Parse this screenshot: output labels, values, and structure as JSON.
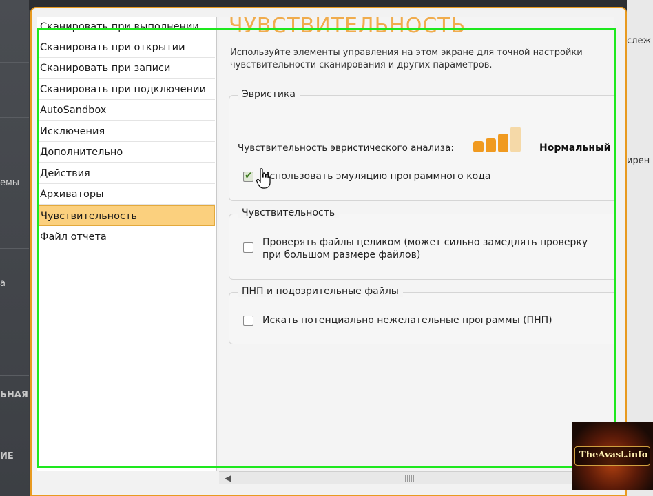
{
  "background_app": {
    "left_labels": [
      "емы",
      "а",
      "ЬНАЯ",
      "ИЕ"
    ],
    "right_labels": [
      "слеж",
      "ирен"
    ]
  },
  "categories": [
    {
      "label": "Сканировать при выполнении",
      "selected": false
    },
    {
      "label": "Сканировать при открытии",
      "selected": false
    },
    {
      "label": "Сканировать при записи",
      "selected": false
    },
    {
      "label": "Сканировать при подключении",
      "selected": false
    },
    {
      "label": "AutoSandbox",
      "selected": false
    },
    {
      "label": "Исключения",
      "selected": false
    },
    {
      "label": "Дополнительно",
      "selected": false
    },
    {
      "label": "Действия",
      "selected": false
    },
    {
      "label": "Архиваторы",
      "selected": false
    },
    {
      "label": "Чувствительность",
      "selected": true
    },
    {
      "label": "Файл отчета",
      "selected": false
    }
  ],
  "panel": {
    "title": "ЧУВСТВИТЕЛЬНОСТЬ",
    "description": "Используйте элементы управления на этом экране для точной настройки чувствительности сканирования и других параметров.",
    "heuristics": {
      "group_title": "Эвристика",
      "sensitivity_label": "Чувствительность эвристического анализа:",
      "level_text": "Нормальный",
      "level_value": 3,
      "level_max": 4,
      "emulation_label": "Использовать эмуляцию программного кода",
      "emulation_checked": true
    },
    "sensitivity": {
      "group_title": "Чувствительность",
      "full_scan_label": "Проверять файлы целиком (может сильно замедлять проверку при большом размере файлов)",
      "full_scan_checked": false
    },
    "pup": {
      "group_title": "ПНП и подозрительные файлы",
      "pup_label": "Искать потенциально нежелательные программы (ПНП)",
      "pup_checked": false
    }
  },
  "watermark": {
    "text": "TheAvast.info"
  },
  "colors": {
    "accent_orange": "#f0a030",
    "selected_bg": "#fbd07e",
    "highlight_green": "#1ee81e",
    "bar_active": "#f09a20",
    "bar_inactive": "#f5d9a8"
  },
  "icons": {
    "cursor": "hand-cursor-icon",
    "scroll_left": "arrow-left-icon"
  }
}
